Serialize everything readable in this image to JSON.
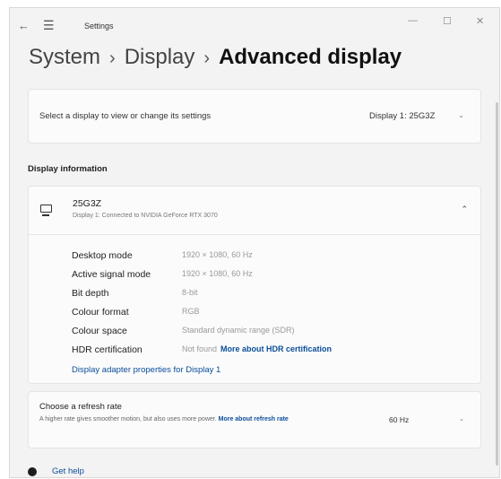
{
  "window": {
    "title": "Settings",
    "back_glyph": "←",
    "menu_glyph": "☰",
    "minimize_glyph": "—",
    "maximize_glyph": "☐",
    "close_glyph": "✕"
  },
  "breadcrumb": {
    "items": [
      "System",
      "Display"
    ],
    "current": "Advanced display",
    "separator": "›"
  },
  "display_select": {
    "label": "Select a display to view or change its settings",
    "value": "Display 1: 25G3Z",
    "chevron": "⌄"
  },
  "display_information": {
    "heading": "Display information",
    "monitor": {
      "icon": "monitor-icon",
      "name": "25G3Z",
      "subtitle": "Display 1: Connected to NVIDIA GeForce RTX 3070",
      "chevron": "⌃"
    },
    "rows": [
      {
        "label": "Desktop mode",
        "value": "1920 × 1080, 60 Hz"
      },
      {
        "label": "Active signal mode",
        "value": "1920 × 1080, 60 Hz"
      },
      {
        "label": "Bit depth",
        "value": "8-bit"
      },
      {
        "label": "Colour format",
        "value": "RGB"
      },
      {
        "label": "Colour space",
        "value": "Standard dynamic range (SDR)"
      },
      {
        "label": "HDR certification",
        "value": "Not found",
        "link": "More about HDR certification"
      }
    ],
    "adapter_link": "Display adapter properties for Display 1"
  },
  "refresh_rate": {
    "title": "Choose a refresh rate",
    "description": "A higher rate gives smoother motion, but also uses more power.",
    "more_link": "More about refresh rate",
    "value": "60 Hz",
    "chevron": "⌄"
  },
  "help": {
    "icon": "help-icon",
    "label": "Get help"
  },
  "colors": {
    "link": "#0b4d99",
    "background": "#f3f3f3",
    "card": "#fbfbfb"
  }
}
